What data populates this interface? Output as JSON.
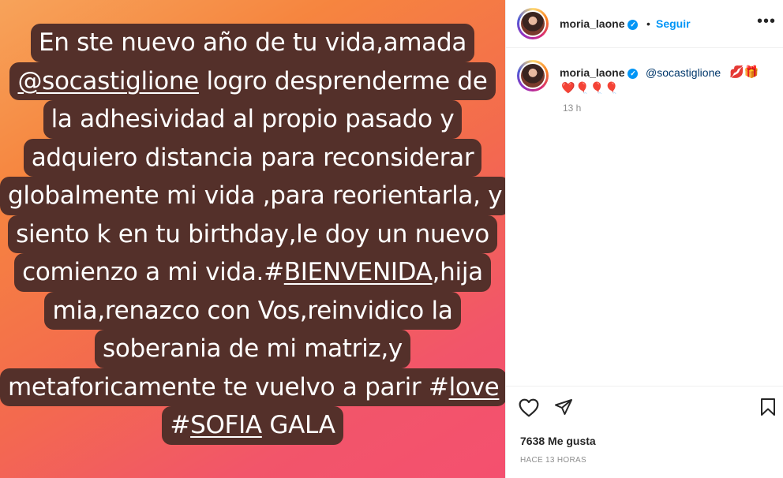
{
  "media": {
    "lines": [
      "En  ste nuevo año de tu vida,amada",
      "@socastiglione logro desprenderme de",
      "la adhesividad al propio pasado y",
      "adquiero distancia para reconsiderar",
      "globalmente mi vida ,para reorientarla, y",
      "siento k en tu birthday,le doy un nuevo",
      "comienzo a mi vida.#BIENVENIDA,hija",
      "mia,renazco con Vos,reinvidico la",
      "soberania de mi matriz,y",
      "metaforicamente te vuelvo a parir #love",
      "#SOFIA GALA"
    ],
    "line2_mention": "@socastiglione",
    "line2_rest": " logro desprenderme de",
    "line7_pre": "comienzo a mi vida.#",
    "line7_tag": "BIENVENIDA",
    "line7_post": ",hija",
    "line10_pre": "metaforicamente te vuelvo a parir #",
    "line10_tag": "love",
    "line11_pre": "#",
    "line11_tag": "SOFIA",
    "line11_post": " GALA"
  },
  "header": {
    "username": "moria_laone",
    "separator": "•",
    "follow_label": "Seguir",
    "more_icon": "more-horizontal-icon",
    "verified_icon": "verified-badge-icon"
  },
  "caption": {
    "username": "moria_laone",
    "mention": "@socastiglione",
    "emojis_line1": "💋🎁",
    "emojis_line2": "❤️🎈🎈🎈",
    "time": "13 h"
  },
  "actions": {
    "like_icon": "heart-icon",
    "share_icon": "send-icon",
    "save_icon": "bookmark-icon"
  },
  "footer": {
    "likes": "7638 Me gusta",
    "posted_ago": "HACE 13 HORAS"
  },
  "colors": {
    "accent": "#0095f6",
    "text_box": "#54302a"
  }
}
